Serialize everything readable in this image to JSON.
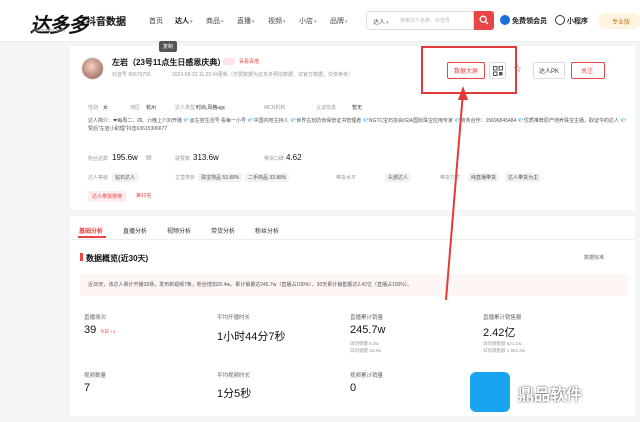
{
  "brand": {
    "logo": "达多多",
    "sub": "抖音数据",
    "domain": "dadaodoo.com"
  },
  "nav": [
    "首页",
    "达人",
    "商品",
    "直播",
    "视频",
    "小店",
    "品牌"
  ],
  "search": {
    "type": "达人",
    "placeholder": "搜索达人名称、抖音号"
  },
  "header_actions": {
    "vip": "免费领会员",
    "mini": "小程序",
    "pro": "专业版"
  },
  "tooltip": "复制",
  "profile": {
    "name": "左岩（23号11点生日感恩庆典）",
    "tag": "百看百搭",
    "douyin_id": "抖音号 90679755",
    "updated": "2023-08-23 11:25:04更新（付费数据为达多多预估数据，非官方数据，仅供参考）",
    "gender": "女",
    "region": "杭州",
    "type": "时尚,风格ugc",
    "mcn": "",
    "auth": "未认证",
    "auth_v": "暂无",
    "desc": "达人简介：❤每周二、四、六晚上7:00开播 💎@左岩生活号 看每一小号 💎中国内地主持人 💎世界古玩防伪保管证书管理者 💎NGTC宝石协会/GIA国际珠宝应用专家 💎商务合作：15696845484 💎优质推荐原产地养珠宝主播，取证今的达人 💎赞后\"左岩小助理\"抖音63615306677"
  },
  "labels": {
    "gender": "性别",
    "region": "地区",
    "type": "达人类型",
    "mcn": "MCN机构",
    "auth": "认证信息",
    "fans": "粉丝总数",
    "likes": "获赞数",
    "rating": "带货口碑",
    "level": "达人等级",
    "main": "主营类目",
    "sales_level": "带货水平",
    "mode": "带货方式",
    "rank": "达人带货排榜"
  },
  "stats": {
    "fans": "195.6w",
    "likes": "313.6w",
    "rating": "4.62"
  },
  "level_tag": "钻石达人",
  "main_cats": [
    {
      "name": "珠宝饰品",
      "pct": "53.88%"
    },
    {
      "name": "二手商品",
      "pct": "33.88%"
    }
  ],
  "sales_level_tag": "头部达人",
  "modes": [
    "纯直播带货",
    "达人带货为主"
  ],
  "rank": {
    "label": "达人带货排榜",
    "pos": "第12名"
  },
  "actions": {
    "dashboard": "数据大屏",
    "pk": "达人PK",
    "follow": "关注"
  },
  "tabs": [
    "基础分析",
    "直播分析",
    "视频分析",
    "带货分析",
    "粉丝分析"
  ],
  "section": {
    "title": "数据概览(近30天)",
    "right": "数据标准"
  },
  "summary": "近30天，该达人累计开播39场，发布新视频7条，粉丝增加20.4w。累计销量达245.7w（直播占100%），30天累计销售额达2.42亿（直播占100%）。",
  "metrics": [
    {
      "label": "直播场次",
      "value": "39",
      "sub": "今日 +1"
    },
    {
      "label": "平均开播时长",
      "value": "1小时44分7秒",
      "sub": ""
    },
    {
      "label": "直播累计销量",
      "value": "245.7w",
      "sub": "场均销量 6.3w",
      "sub2": "日均销量 18.9w"
    },
    {
      "label": "直播累计销售额",
      "value": "2.42亿",
      "sub": "场均销售额 621.1w",
      "sub2": "日均销售额 1,863.2w"
    },
    {
      "label": "视频数量",
      "value": "7",
      "sub": ""
    },
    {
      "label": "平均视频时长",
      "value": "1分5秒",
      "sub": ""
    },
    {
      "label": "视频累计销量",
      "value": "0",
      "sub": ""
    }
  ],
  "watermark": "鼎品软件",
  "colors": {
    "accent": "#e94545",
    "highlight": "#e23b3b"
  }
}
